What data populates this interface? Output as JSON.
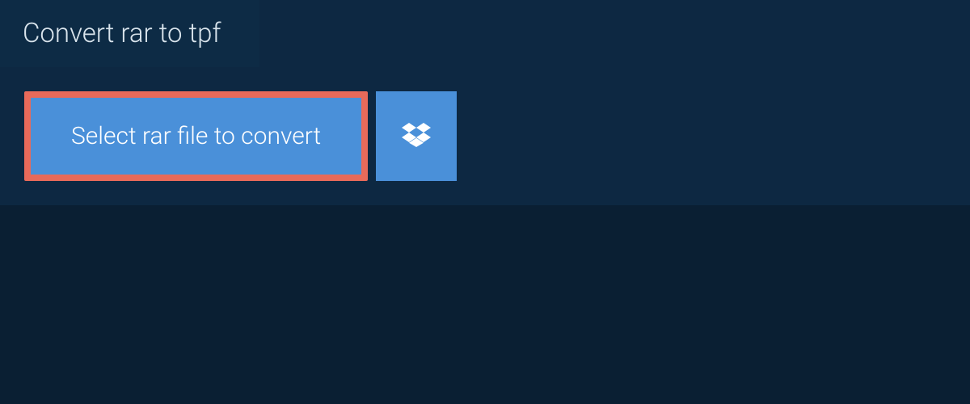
{
  "tab": {
    "title": "Convert rar to tpf"
  },
  "buttons": {
    "select_file_label": "Select rar file to convert",
    "dropbox_icon": "dropbox-icon"
  },
  "colors": {
    "page_bg": "#0a1f33",
    "panel_bg": "#0d2842",
    "tab_bg": "#0d2b45",
    "button_bg": "#4a90d9",
    "highlight_border": "#e86a5a",
    "text_light": "#d9e4ec"
  }
}
